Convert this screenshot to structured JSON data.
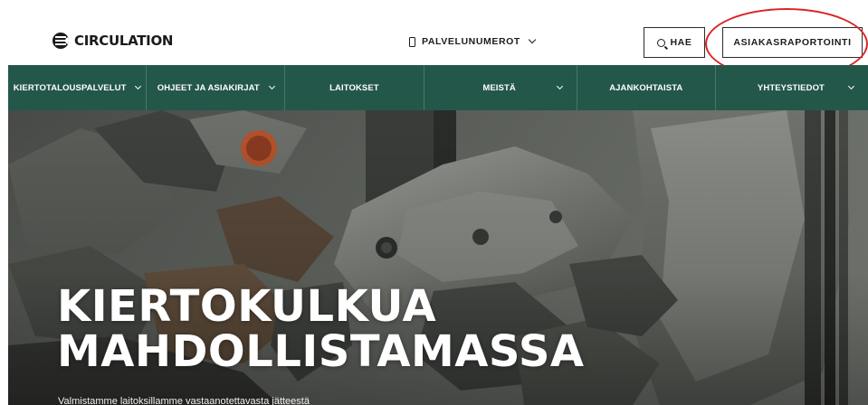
{
  "header": {
    "logo_text": "CIRCULATION",
    "numbers_label": "PALVELUNUMEROT",
    "search_label": "HAE",
    "portal_label": "ASIAKASRAPORTOINTI"
  },
  "nav": {
    "items": [
      {
        "label": "KIERTOTALOUSPALVELUT"
      },
      {
        "label": "OHJEET JA ASIAKIRJAT"
      },
      {
        "label": "LAITOKSET"
      },
      {
        "label": "MEISTÄ"
      },
      {
        "label": "AJANKOHTAISTA"
      },
      {
        "label": "YHTEYSTIEDOT"
      }
    ]
  },
  "hero": {
    "title_line1": "KIERTOKULKUA",
    "title_line2": "MAHDOLLISTAMASSA",
    "subtitle": "Valmistamme laitoksillamme vastaanotettavasta jätteestä"
  },
  "colors": {
    "nav_background": "#23574a",
    "annotation": "#d92525"
  },
  "icons": {
    "logo": "circulation-logo-icon",
    "phone": "phone-icon",
    "search": "search-icon",
    "dropdown": "chevron-down-icon"
  }
}
